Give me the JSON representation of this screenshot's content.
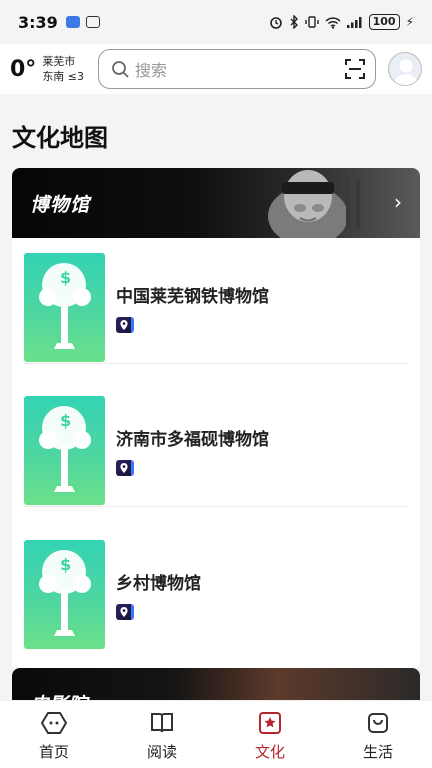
{
  "status_bar": {
    "time": "3:39",
    "battery": "100"
  },
  "weather": {
    "temp": "0°",
    "city": "莱芜市",
    "wind": "东南 ≤3"
  },
  "search": {
    "placeholder": "搜索"
  },
  "page_title": "文化地图",
  "museum_section": {
    "title": "博物馆",
    "items": [
      {
        "name": "中国莱芜钢铁博物馆"
      },
      {
        "name": "济南市多福砚博物馆"
      },
      {
        "name": "乡村博物馆"
      }
    ]
  },
  "cinema_section": {
    "title": "电影院"
  },
  "tabbar": {
    "tabs": [
      {
        "label": "首页",
        "icon": "home-icon"
      },
      {
        "label": "阅读",
        "icon": "book-icon"
      },
      {
        "label": "文化",
        "icon": "culture-icon"
      },
      {
        "label": "生活",
        "icon": "shopping-bag-icon"
      }
    ],
    "active_index": 2,
    "active_color": "#b3262e"
  }
}
